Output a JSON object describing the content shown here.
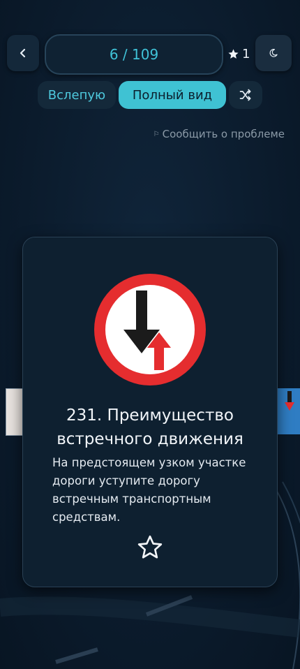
{
  "header": {
    "counter": "6 / 109",
    "favorites_count": "1"
  },
  "modes": {
    "blind_label": "Вслепую",
    "full_label": "Полный вид"
  },
  "report": {
    "label": "Сообщить о проблеме"
  },
  "card": {
    "title": "231. Преимущество встречного движения",
    "description": "На предстоящем узком участке дороги уступите дорогу встречным транспортным средствам."
  },
  "colors": {
    "accent": "#3fc2d3",
    "background": "#0b1b2c",
    "sign_red": "#e52d2f"
  },
  "icons": [
    "back-icon",
    "star-filled-icon",
    "moon-icon",
    "shuffle-icon",
    "flag-icon",
    "star-outline-icon"
  ]
}
